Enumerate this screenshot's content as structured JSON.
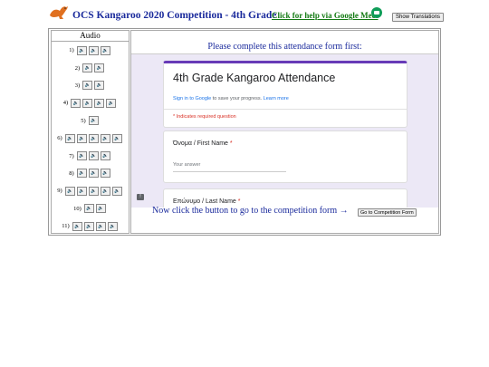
{
  "header": {
    "title": "OCS Kangaroo 2020 Competition - 4th Grade",
    "help_link": "Click for help via Google Meet",
    "translate_button": "Show Translations"
  },
  "audio": {
    "heading": "Audio",
    "rows": [
      {
        "num": "1)",
        "buttons": 3
      },
      {
        "num": "2)",
        "buttons": 2
      },
      {
        "num": "3)",
        "buttons": 2
      },
      {
        "num": "4)",
        "buttons": 4
      },
      {
        "num": "5)",
        "buttons": 1
      },
      {
        "num": "6)",
        "buttons": 5
      },
      {
        "num": "7)",
        "buttons": 3
      },
      {
        "num": "8)",
        "buttons": 3
      },
      {
        "num": "9)",
        "buttons": 5
      },
      {
        "num": "10)",
        "buttons": 2
      },
      {
        "num": "11)",
        "buttons": 4
      }
    ],
    "button_glyph": "🔈"
  },
  "main": {
    "instruction": "Please complete this attendance form first:",
    "form": {
      "title": "4th Grade Kangaroo Attendance",
      "signin_link": "Sign in to Google",
      "signin_rest": " to save your progress. ",
      "learn_more": "Learn more",
      "required_note": "* Indicates required question",
      "q1_label": "Όνομα / First Name",
      "q1_placeholder": "Your answer",
      "q2_label": "Επώνυμο / Last Name",
      "required_star": "*"
    },
    "next_text": "Now click the button to go to the competition form →",
    "go_button": "Go to Competition Form"
  },
  "colors": {
    "title_blue": "#1a2a9c",
    "link_green": "#137a13",
    "form_accent": "#673ab7",
    "form_bg": "#ece8f6",
    "required_red": "#d93025"
  }
}
